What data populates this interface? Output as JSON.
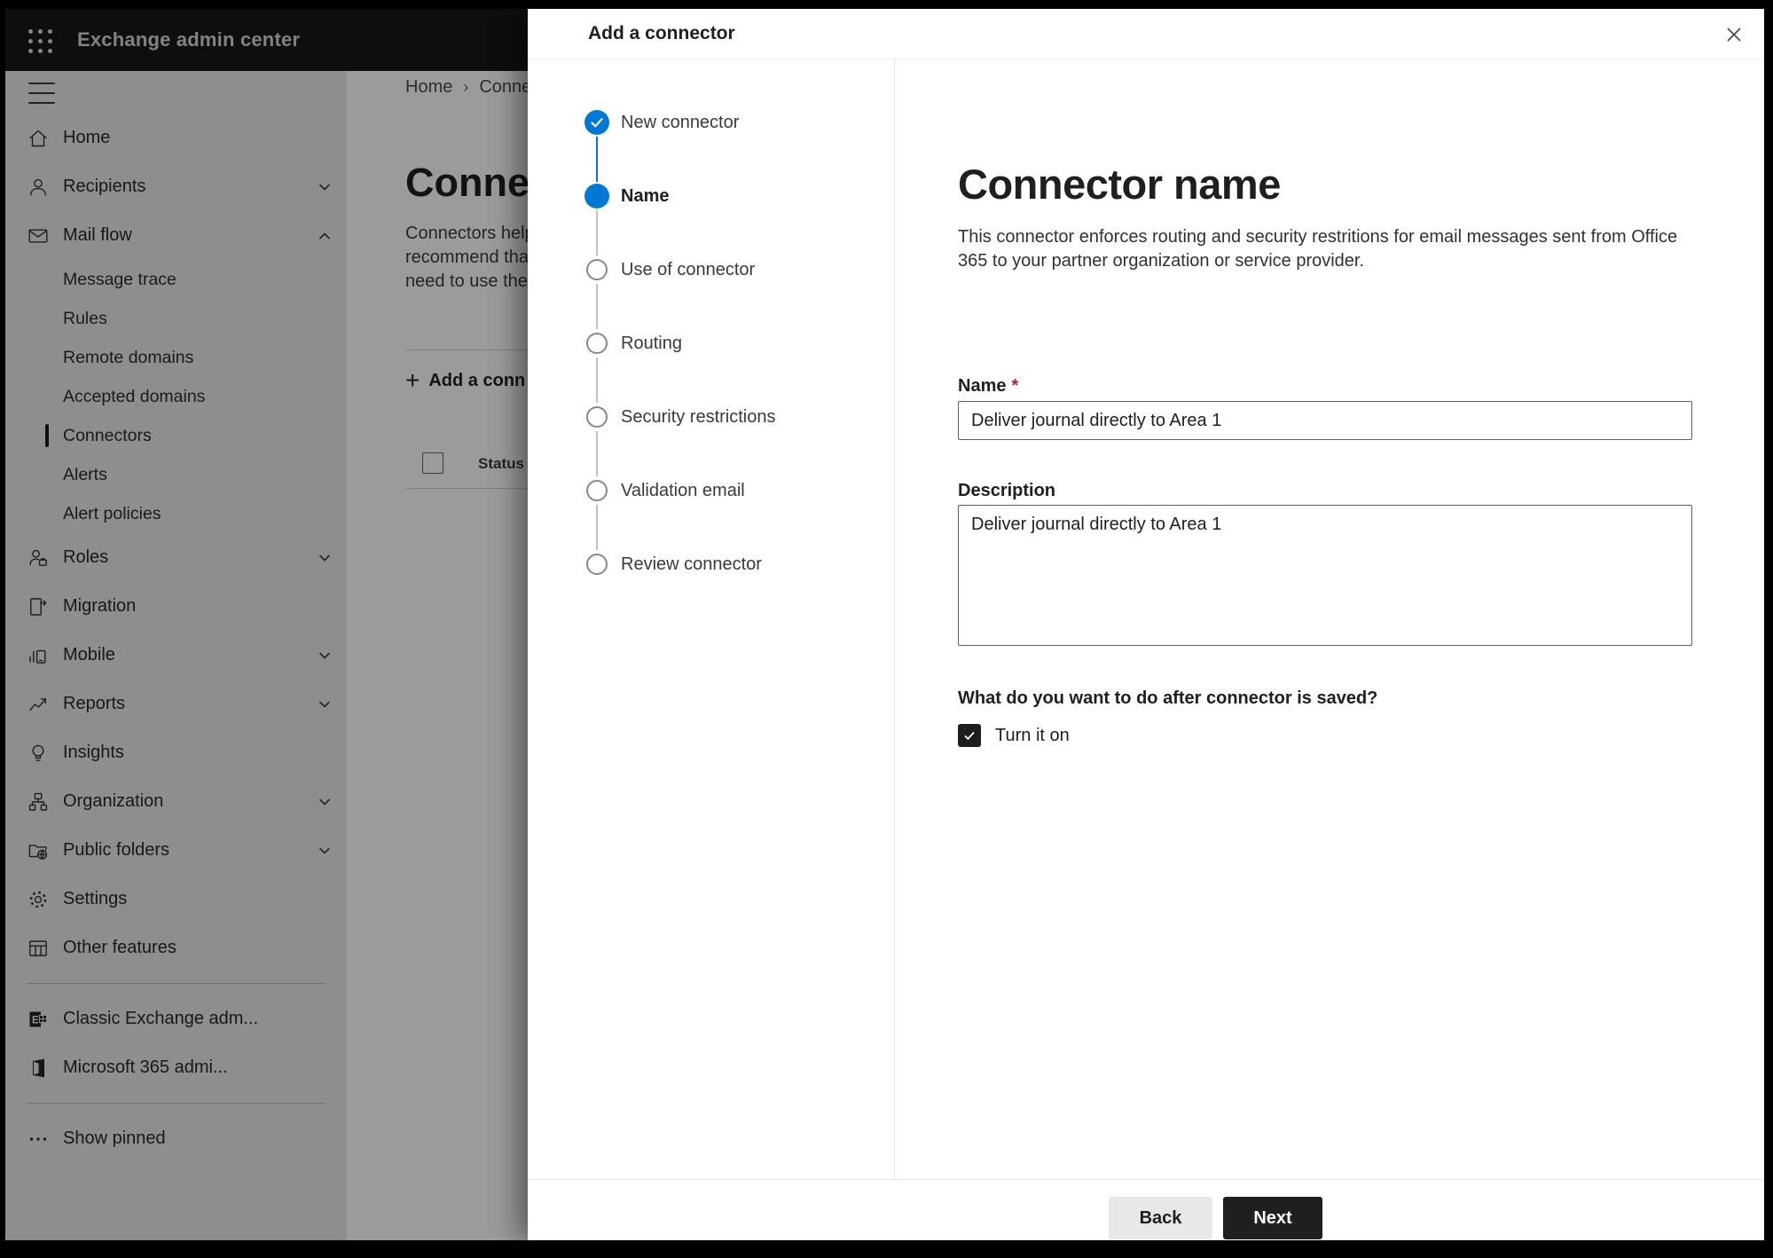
{
  "topbar": {
    "title": "Exchange admin center"
  },
  "sidebar": {
    "items": [
      {
        "label": "Home",
        "icon": "home-icon"
      },
      {
        "label": "Recipients",
        "icon": "person-icon",
        "chevron": "down"
      },
      {
        "label": "Mail flow",
        "icon": "mail-icon",
        "chevron": "up"
      },
      {
        "label": "Message trace",
        "type": "sub"
      },
      {
        "label": "Rules",
        "type": "sub"
      },
      {
        "label": "Remote domains",
        "type": "sub"
      },
      {
        "label": "Accepted domains",
        "type": "sub"
      },
      {
        "label": "Connectors",
        "type": "sub",
        "selected": true
      },
      {
        "label": "Alerts",
        "type": "sub"
      },
      {
        "label": "Alert policies",
        "type": "sub"
      },
      {
        "label": "Roles",
        "icon": "roles-icon",
        "chevron": "down"
      },
      {
        "label": "Migration",
        "icon": "migration-icon"
      },
      {
        "label": "Mobile",
        "icon": "mobile-icon",
        "chevron": "down"
      },
      {
        "label": "Reports",
        "icon": "reports-icon",
        "chevron": "down"
      },
      {
        "label": "Insights",
        "icon": "insights-icon"
      },
      {
        "label": "Organization",
        "icon": "organization-icon",
        "chevron": "down"
      },
      {
        "label": "Public folders",
        "icon": "public-folders-icon",
        "chevron": "down"
      },
      {
        "label": "Settings",
        "icon": "settings-icon"
      },
      {
        "label": "Other features",
        "icon": "other-features-icon"
      },
      {
        "type": "divider"
      },
      {
        "label": "Classic Exchange adm...",
        "icon": "exchange-logo-icon"
      },
      {
        "label": "Microsoft 365 admi...",
        "icon": "m365-logo-icon"
      },
      {
        "type": "divider"
      },
      {
        "label": "Show pinned",
        "icon": "ellipsis-icon"
      }
    ]
  },
  "background_page": {
    "breadcrumb_home": "Home",
    "breadcrumb_current": "Conne",
    "title": "Connec",
    "description_lines": [
      "Connectors help",
      "recommend that",
      "need to use ther"
    ],
    "add_button": "Add a conn",
    "status_header": "Status"
  },
  "modal": {
    "title": "Add a connector",
    "steps": [
      {
        "label": "New connector",
        "state": "completed"
      },
      {
        "label": "Name",
        "state": "current"
      },
      {
        "label": "Use of connector",
        "state": "upcoming"
      },
      {
        "label": "Routing",
        "state": "upcoming"
      },
      {
        "label": "Security restrictions",
        "state": "upcoming"
      },
      {
        "label": "Validation email",
        "state": "upcoming"
      },
      {
        "label": "Review connector",
        "state": "upcoming"
      }
    ],
    "content": {
      "heading": "Connector name",
      "description": "This connector enforces routing and security restritions for email messages sent from Office 365 to your partner organization or service provider.",
      "name_label": "Name",
      "required_marker": "*",
      "name_value": "Deliver journal directly to Area 1",
      "description_label": "Description",
      "description_value": "Deliver journal directly to Area 1",
      "after_save_question": "What do you want to do after connector is saved?",
      "turn_on_label": "Turn it on",
      "turn_on_checked": true
    },
    "footer": {
      "back_label": "Back",
      "next_label": "Next"
    }
  },
  "colors": {
    "accent": "#0078d4",
    "required": "#a4262c",
    "topbar": "#191817"
  }
}
